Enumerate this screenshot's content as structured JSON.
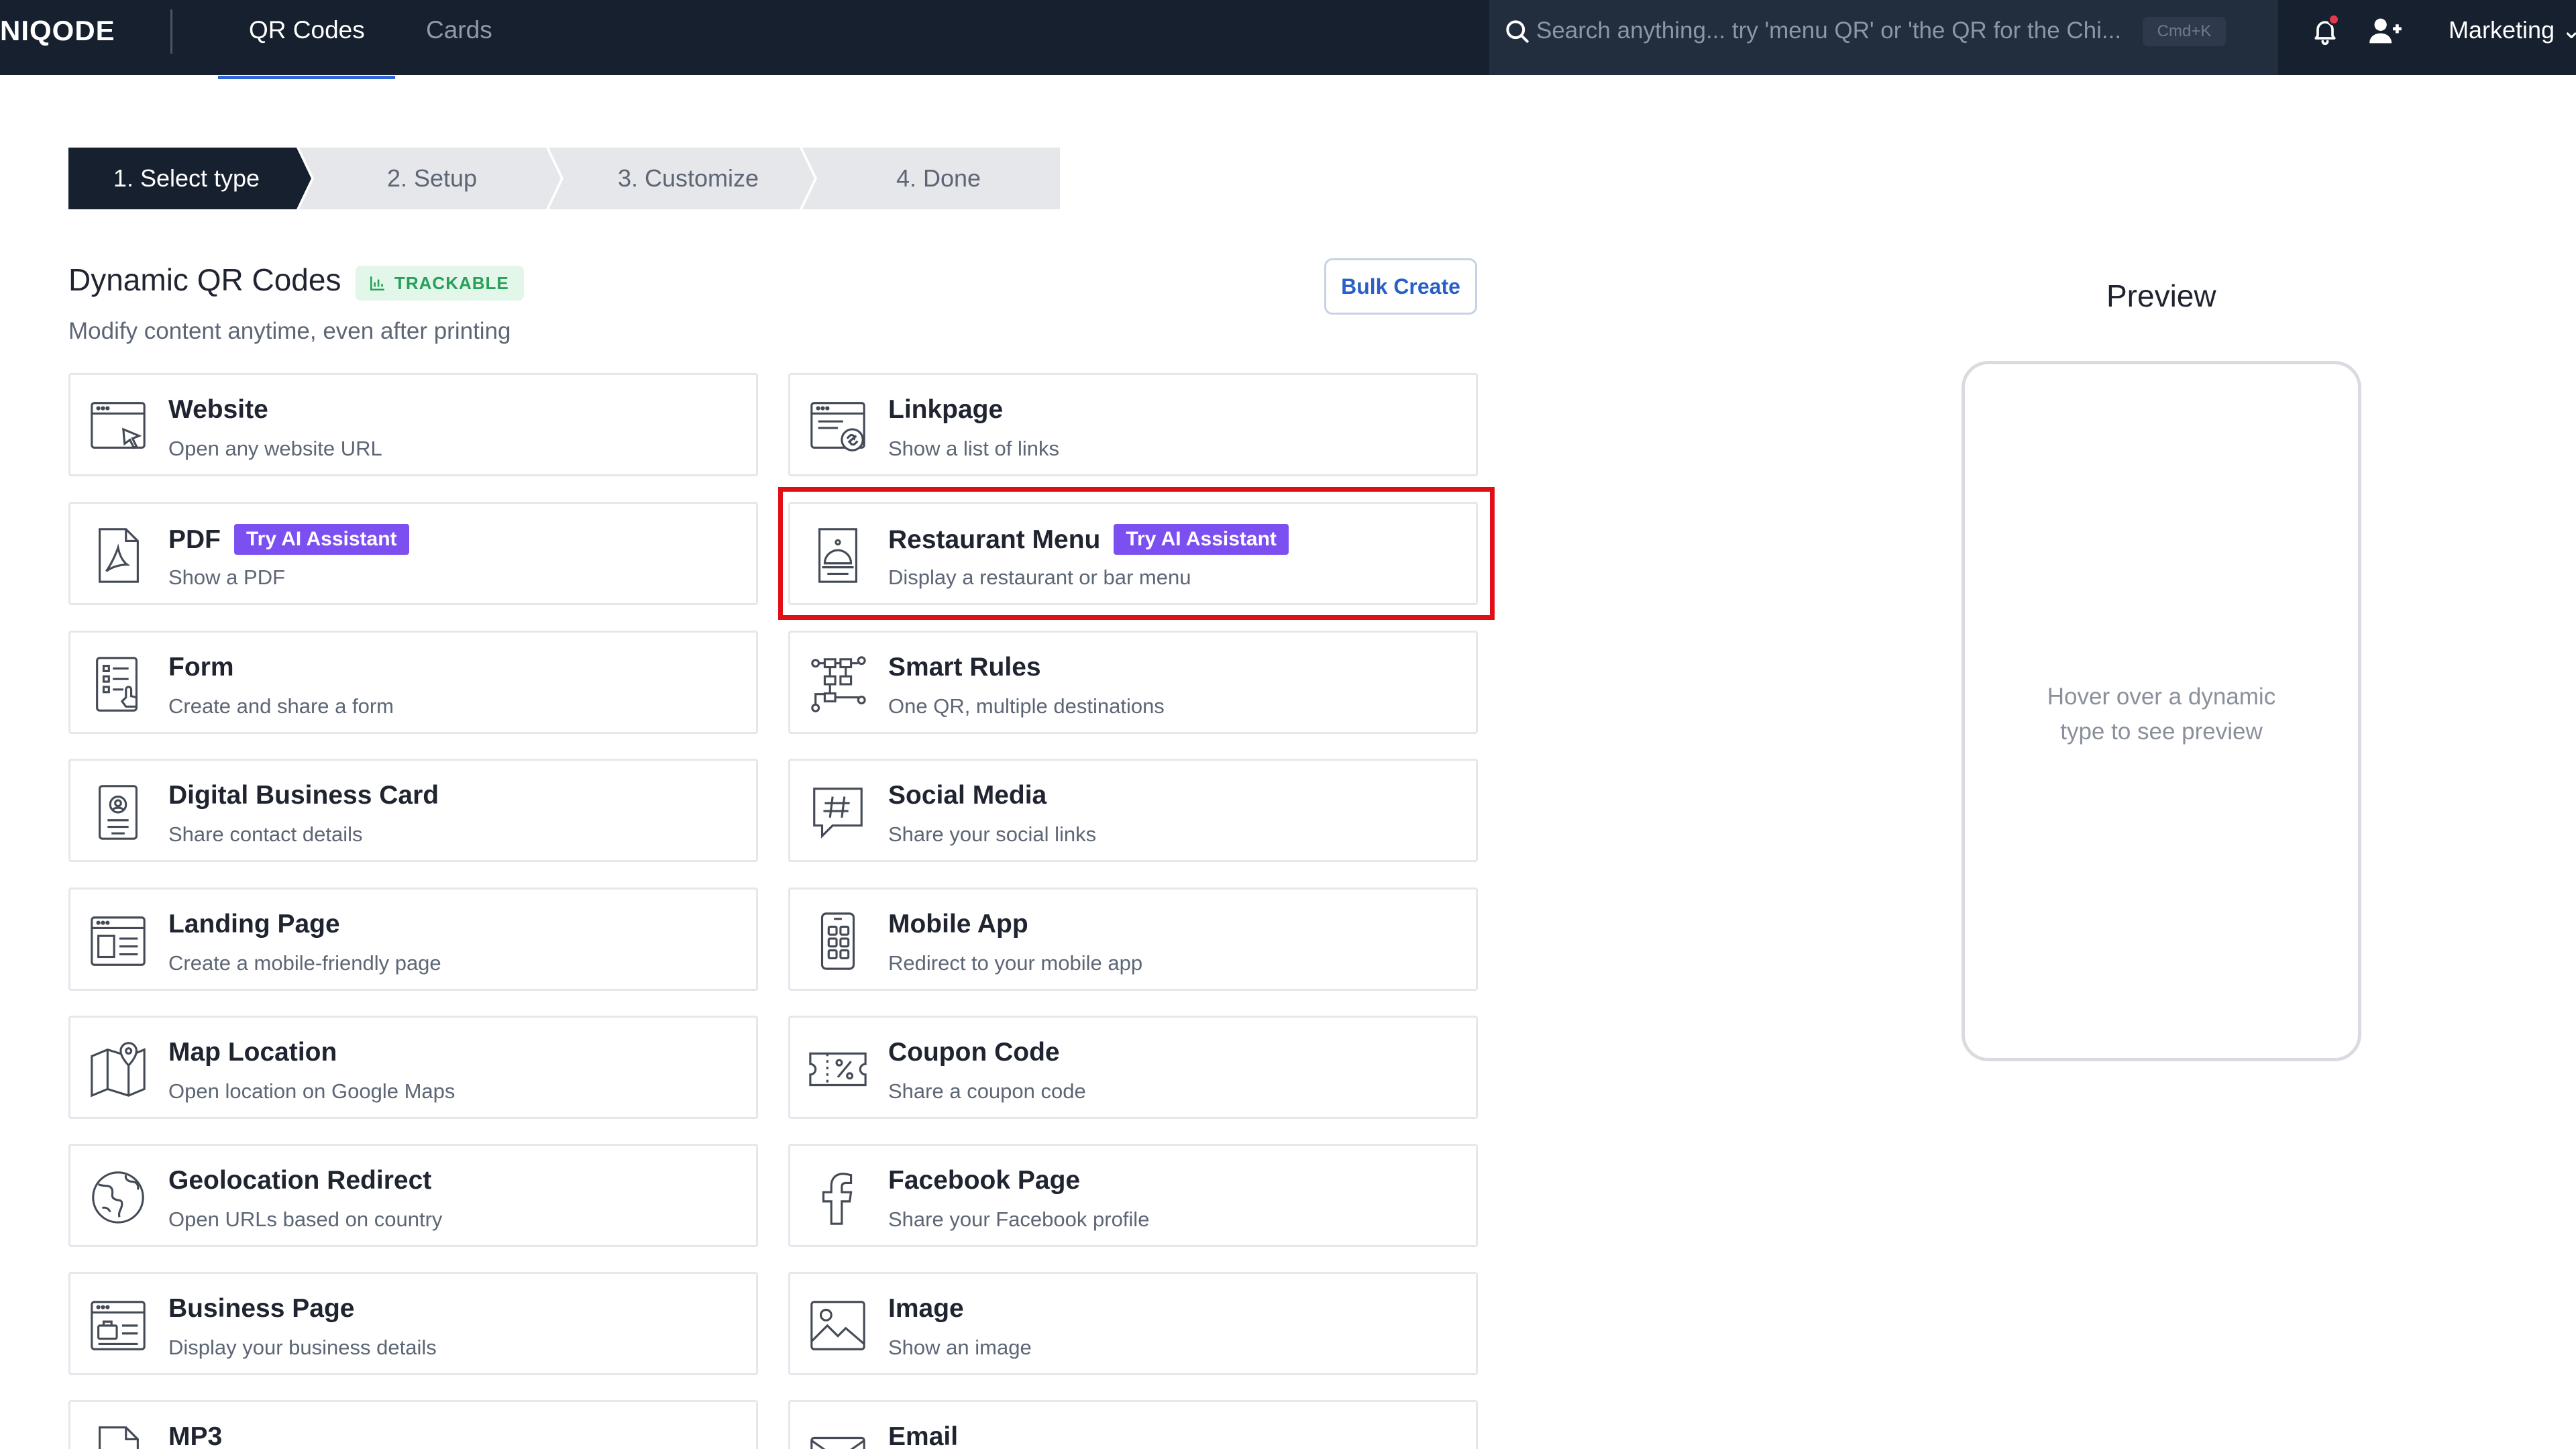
{
  "nav": {
    "logo": "NIQODE",
    "tabs": [
      {
        "label": "QR Codes",
        "active": true
      },
      {
        "label": "Cards",
        "active": false
      }
    ],
    "search_placeholder": "Search anything... try 'menu QR' or 'the QR for the Chi...",
    "search_shortcut": "Cmd+K",
    "workspace": "Marketing"
  },
  "stepper": [
    "1. Select type",
    "2. Setup",
    "3. Customize",
    "4. Done"
  ],
  "section": {
    "title": "Dynamic QR Codes",
    "badge": "TRACKABLE",
    "subtitle": "Modify content anytime, even after printing",
    "bulk_button": "Bulk Create"
  },
  "ai_badge": "Try AI Assistant",
  "cards": [
    {
      "title": "Website",
      "desc": "Open any website URL",
      "icon": "browser-cursor-icon"
    },
    {
      "title": "Linkpage",
      "desc": "Show a list of links",
      "icon": "browser-link-icon"
    },
    {
      "title": "PDF",
      "desc": "Show a PDF",
      "icon": "pdf-file-icon",
      "ai": true
    },
    {
      "title": "Restaurant Menu",
      "desc": "Display a restaurant or bar menu",
      "icon": "cloche-icon",
      "ai": true
    },
    {
      "title": "Form",
      "desc": "Create and share a form",
      "icon": "form-icon"
    },
    {
      "title": "Smart Rules",
      "desc": "One QR, multiple destinations",
      "icon": "flow-icon"
    },
    {
      "title": "Digital Business Card",
      "desc": "Share contact details",
      "icon": "contact-card-icon"
    },
    {
      "title": "Social Media",
      "desc": "Share your social links",
      "icon": "hashtag-icon"
    },
    {
      "title": "Landing Page",
      "desc": "Create a mobile-friendly page",
      "icon": "landing-page-icon"
    },
    {
      "title": "Mobile App",
      "desc": "Redirect to your mobile app",
      "icon": "mobile-app-icon"
    },
    {
      "title": "Map Location",
      "desc": "Open location on Google Maps",
      "icon": "map-pin-icon"
    },
    {
      "title": "Coupon Code",
      "desc": "Share a coupon code",
      "icon": "coupon-icon"
    },
    {
      "title": "Geolocation Redirect",
      "desc": "Open URLs based on country",
      "icon": "globe-icon"
    },
    {
      "title": "Facebook Page",
      "desc": "Share your Facebook profile",
      "icon": "facebook-icon"
    },
    {
      "title": "Business Page",
      "desc": "Display your business details",
      "icon": "business-page-icon"
    },
    {
      "title": "Image",
      "desc": "Show an image",
      "icon": "image-icon"
    },
    {
      "title": "MP3",
      "desc": "",
      "icon": "audio-file-icon"
    },
    {
      "title": "Email",
      "desc": "",
      "icon": "envelope-icon"
    }
  ],
  "preview": {
    "title": "Preview",
    "placeholder_line1": "Hover over a dynamic",
    "placeholder_line2": "type to see preview"
  },
  "colors": {
    "nav_bg": "#16202e",
    "accent": "#2f67d8",
    "ai_badge": "#7c4ff0",
    "trackable_text": "#27a05a",
    "highlight": "#e00f17"
  }
}
